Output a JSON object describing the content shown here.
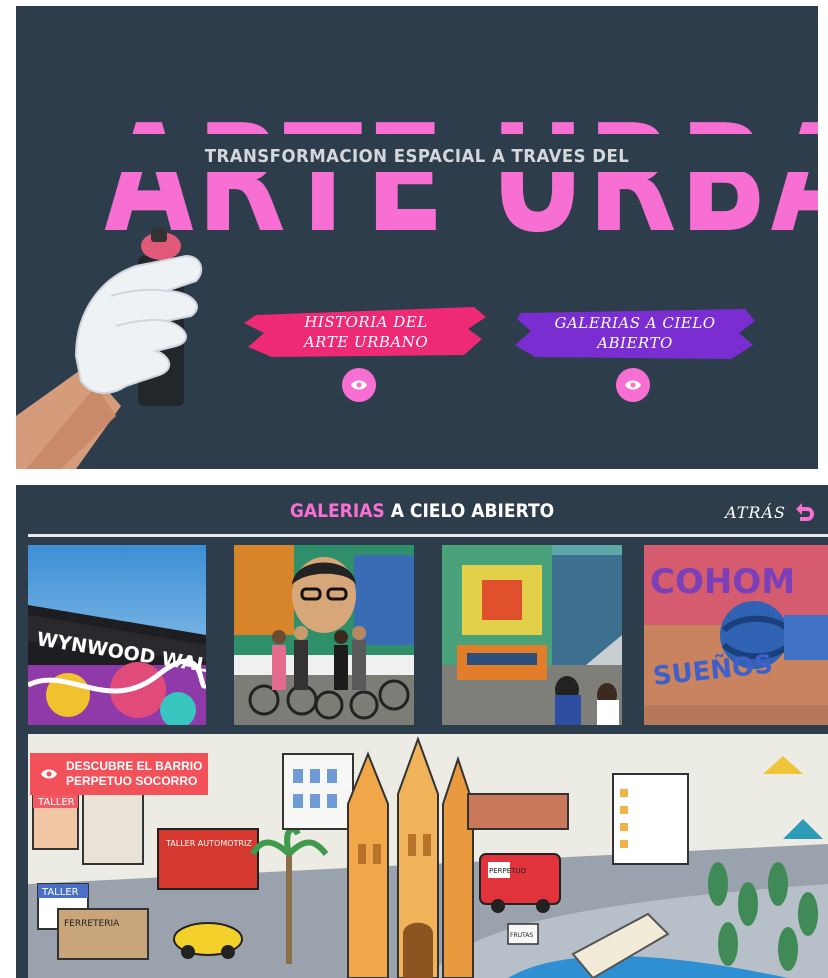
{
  "hero": {
    "title": "ARTE URBANO",
    "subtitle": "TRANSFORMACION ESPACIAL A TRAVES DEL",
    "buttons": [
      {
        "label": "HISTORIA DEL ARTE URBANO",
        "color": "#ee2a74"
      },
      {
        "label": "GALERIAS A CIELO ABIERTO",
        "color": "#7a2ed1"
      }
    ],
    "colors": {
      "background": "#2e3d4c",
      "accent": "#f76fd3"
    }
  },
  "gallery": {
    "title_highlight": "GALERIAS",
    "title_rest": " A CIELO ABIERTO",
    "back_label": "ATRÁS",
    "photos": [
      {
        "sign_text": "WYNWOOD WALLS"
      },
      {
        "description": "graffiti-cyclists"
      },
      {
        "description": "metro-murals"
      },
      {
        "wall_text": "SUEÑOS"
      }
    ],
    "map": {
      "discover_label": "DESCUBRE EL BARRIO PERPETUO SOCORRO",
      "sign_labels": [
        "TALLER",
        "TALLER AUTOMOTRIZ",
        "TALLER",
        "FERRETERIA",
        "PERPETUO",
        "FRUTAS"
      ]
    }
  }
}
